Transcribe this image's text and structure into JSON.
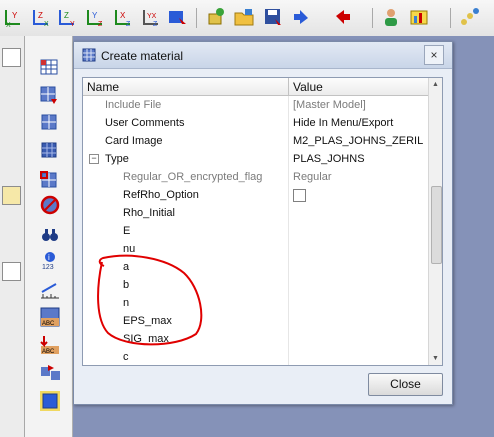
{
  "dialog": {
    "title": "Create material",
    "close_glyph": "×",
    "close_button": "Close"
  },
  "grid": {
    "header_name": "Name",
    "header_value": "Value",
    "rows": [
      {
        "name": "Include File",
        "value": "[Master Model]"
      },
      {
        "name": "User Comments",
        "value": "Hide In Menu/Export"
      },
      {
        "name": "Card Image",
        "value": "M2_PLAS_JOHNS_ZERIL"
      },
      {
        "name": "Type",
        "value": "PLAS_JOHNS",
        "expander": "−"
      },
      {
        "name": "Regular_OR_encrypted_flag",
        "value": "Regular"
      },
      {
        "name": "RefRho_Option",
        "value": ""
      },
      {
        "name": "Rho_Initial",
        "value": ""
      },
      {
        "name": "E",
        "value": ""
      },
      {
        "name": "nu",
        "value": ""
      },
      {
        "name": "a",
        "value": ""
      },
      {
        "name": "b",
        "value": ""
      },
      {
        "name": "n",
        "value": ""
      },
      {
        "name": "EPS_max",
        "value": ""
      },
      {
        "name": "SIG_max",
        "value": ""
      },
      {
        "name": "c",
        "value": ""
      }
    ]
  },
  "left_tools": {
    "count_label": "123",
    "abc_label_1": "ABC",
    "abc_label_2": "ABC"
  },
  "colors": {
    "annotation": "#e00000",
    "workspace": "#8592b8"
  },
  "icons": [
    "axis-yx-icon",
    "axis-zx-icon",
    "axis-zy-icon",
    "axis-xz-icon",
    "axis-yz-icon",
    "axis-xyz-icon",
    "view-icon",
    "tool-icon",
    "folder-open-icon",
    "save-icon",
    "undo-icon",
    "redo-icon",
    "user-icon",
    "chart-icon",
    "layers-icon"
  ]
}
